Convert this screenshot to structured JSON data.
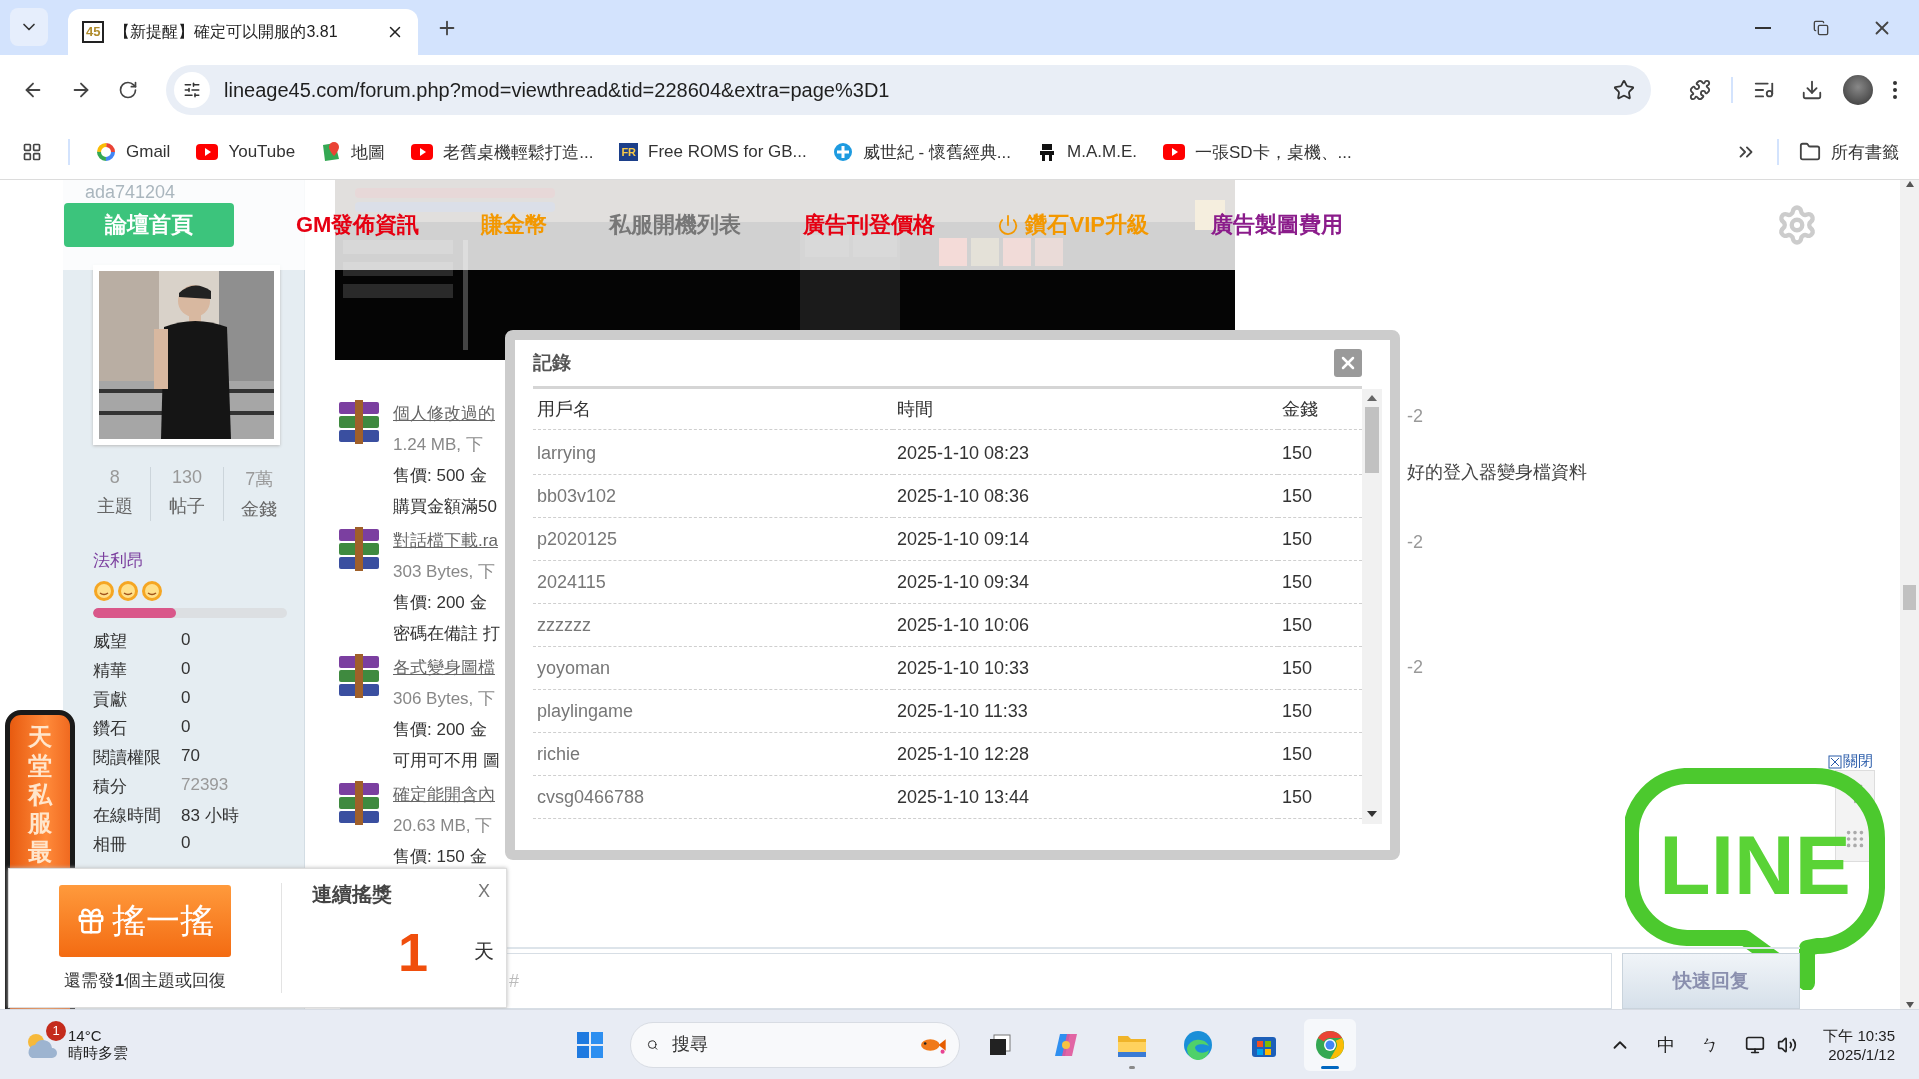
{
  "browser": {
    "tab": {
      "favicon_text": "45",
      "title": "【新提醒】確定可以開服的3.81"
    },
    "address": {
      "url": "lineage45.com/forum.php?mod=viewthread&tid=228604&extra=page%3D1"
    },
    "bookmarks": [
      {
        "kind": "gmail",
        "label": "Gmail"
      },
      {
        "kind": "youtube",
        "label": "YouTube"
      },
      {
        "kind": "maps",
        "label": "地圖"
      },
      {
        "kind": "youtube",
        "label": "老舊桌機輕鬆打造..."
      },
      {
        "kind": "badge",
        "badge": "FR",
        "label": "Free ROMS for GB..."
      },
      {
        "kind": "swirl",
        "label": "威世紀 - 懷舊經典..."
      },
      {
        "kind": "mame",
        "label": "M.A.M.E."
      },
      {
        "kind": "youtube",
        "label": "一張SD卡，桌機、..."
      }
    ],
    "all_bookmarks": "所有書籤"
  },
  "nav": {
    "items": [
      {
        "label": "論壇首頁",
        "selected": true,
        "kind": "plain"
      },
      {
        "label": "GM發佈資訊",
        "selected": false,
        "kind": "plain",
        "color": "#e60012"
      },
      {
        "label": "賺金幣",
        "selected": false,
        "kind": "plain",
        "color": "#f39800"
      },
      {
        "label": "私服開機列表",
        "selected": false,
        "kind": "plain",
        "color": "#777777"
      },
      {
        "label": "廣告刊登價格",
        "selected": false,
        "kind": "plain",
        "color": "#e60012"
      },
      {
        "label": "鑽石VIP升級",
        "selected": false,
        "kind": "power",
        "color": "#f39800"
      },
      {
        "label": "廣告製圖費用",
        "selected": false,
        "kind": "plain",
        "color": "#8b1c8b"
      }
    ]
  },
  "sidebar": {
    "username": "ada741204",
    "stats": [
      {
        "value": "8",
        "label": "主題"
      },
      {
        "value": "130",
        "label": "帖子"
      },
      {
        "value": "7萬",
        "label": "金錢"
      }
    ],
    "group": "法利昂",
    "medals": [
      {
        "kind": "smiley"
      },
      {
        "kind": "smiley"
      },
      {
        "kind": "smiley"
      }
    ],
    "level": 0.43,
    "rows": [
      {
        "label": "威望",
        "value": "0",
        "muted": false
      },
      {
        "label": "精華",
        "value": "0",
        "muted": false
      },
      {
        "label": "貢獻",
        "value": "0",
        "muted": false
      },
      {
        "label": "鑽石",
        "value": "0",
        "muted": false
      },
      {
        "label": "閱讀權限",
        "value": "70",
        "muted": false
      },
      {
        "label": "積分",
        "value": "72393",
        "muted": true
      },
      {
        "label": "在線時間",
        "value": "83 小時",
        "muted": false
      },
      {
        "label": "相冊",
        "value": "0",
        "muted": false
      }
    ]
  },
  "attachments": [
    {
      "title": "個人修改過的",
      "meta": "1.24 MB, 下",
      "price": "售價: 500 金",
      "note": "購買金額滿50"
    },
    {
      "title": "對話檔下載.ra",
      "meta": "303 Bytes, 下",
      "price": "售價: 200 金",
      "note": "密碼在備註 打"
    },
    {
      "title": "各式變身圖檔",
      "meta": "306 Bytes, 下",
      "price": "售價: 200 金",
      "note": "可用可不用 圖"
    },
    {
      "title": "確定能開含內",
      "meta": "20.63 MB, 下",
      "price": "售價: 150 金"
    }
  ],
  "side_notes": [
    "-2",
    "好的登入器變身檔資料",
    "-2",
    "-2"
  ],
  "modal": {
    "title": "記錄",
    "columns": [
      "用戶名",
      "時間",
      "金錢"
    ],
    "rows": [
      {
        "user": "larrying",
        "time": "2025-1-10 08:23",
        "money": "150"
      },
      {
        "user": "bb03v102",
        "time": "2025-1-10 08:36",
        "money": "150"
      },
      {
        "user": "p2020125",
        "time": "2025-1-10 09:14",
        "money": "150"
      },
      {
        "user": "2024115",
        "time": "2025-1-10 09:34",
        "money": "150"
      },
      {
        "user": "zzzzzz",
        "time": "2025-1-10 10:06",
        "money": "150"
      },
      {
        "user": "yoyoman",
        "time": "2025-1-10 10:33",
        "money": "150"
      },
      {
        "user": "playlingame",
        "time": "2025-1-10 11:33",
        "money": "150"
      },
      {
        "user": "richie",
        "time": "2025-1-10 12:28",
        "money": "150"
      },
      {
        "user": "cvsg0466788",
        "time": "2025-1-10 13:44",
        "money": "150"
      }
    ]
  },
  "banner": {
    "text": "天堂私服最"
  },
  "shake": {
    "button": "搖一搖",
    "hint": "還需發**1**個主題或回復",
    "title": "連續搖獎",
    "close": "X",
    "days": "1",
    "unit": "天"
  },
  "side_tools": {
    "close": "關閉"
  },
  "line_logo": {
    "text": "LINE"
  },
  "quick_reply": {
    "placeholder": "#",
    "button": "快速回复"
  },
  "taskbar": {
    "weather": {
      "badge": "1",
      "temp": "14°C",
      "desc": "晴時多雲"
    },
    "search": {
      "placeholder": "搜尋"
    },
    "apps": [
      {
        "kind": "taskview",
        "active": false,
        "running": false
      },
      {
        "kind": "copilot",
        "active": false,
        "running": false
      },
      {
        "kind": "explorer",
        "active": false,
        "running": true
      },
      {
        "kind": "edge",
        "active": false,
        "running": false
      },
      {
        "kind": "store",
        "active": false,
        "running": false
      },
      {
        "kind": "chrome",
        "active": true,
        "running": true
      }
    ],
    "tray": {
      "ime": "中",
      "input": "ㄅ",
      "time": "下午 10:35",
      "date": "2025/1/12"
    }
  }
}
